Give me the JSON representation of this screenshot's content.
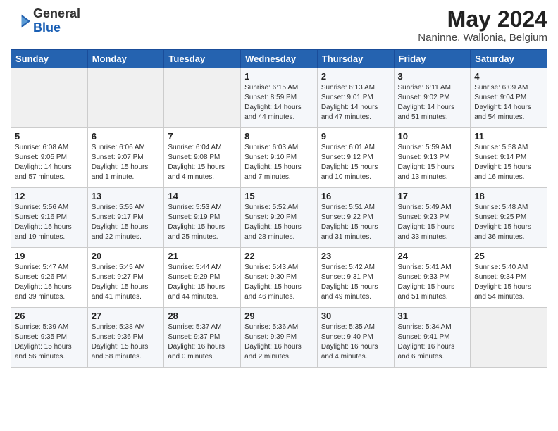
{
  "header": {
    "logo_general": "General",
    "logo_blue": "Blue",
    "month_title": "May 2024",
    "location": "Naninne, Wallonia, Belgium"
  },
  "weekdays": [
    "Sunday",
    "Monday",
    "Tuesday",
    "Wednesday",
    "Thursday",
    "Friday",
    "Saturday"
  ],
  "weeks": [
    [
      {
        "day": "",
        "info": ""
      },
      {
        "day": "",
        "info": ""
      },
      {
        "day": "",
        "info": ""
      },
      {
        "day": "1",
        "info": "Sunrise: 6:15 AM\nSunset: 8:59 PM\nDaylight: 14 hours\nand 44 minutes."
      },
      {
        "day": "2",
        "info": "Sunrise: 6:13 AM\nSunset: 9:01 PM\nDaylight: 14 hours\nand 47 minutes."
      },
      {
        "day": "3",
        "info": "Sunrise: 6:11 AM\nSunset: 9:02 PM\nDaylight: 14 hours\nand 51 minutes."
      },
      {
        "day": "4",
        "info": "Sunrise: 6:09 AM\nSunset: 9:04 PM\nDaylight: 14 hours\nand 54 minutes."
      }
    ],
    [
      {
        "day": "5",
        "info": "Sunrise: 6:08 AM\nSunset: 9:05 PM\nDaylight: 14 hours\nand 57 minutes."
      },
      {
        "day": "6",
        "info": "Sunrise: 6:06 AM\nSunset: 9:07 PM\nDaylight: 15 hours\nand 1 minute."
      },
      {
        "day": "7",
        "info": "Sunrise: 6:04 AM\nSunset: 9:08 PM\nDaylight: 15 hours\nand 4 minutes."
      },
      {
        "day": "8",
        "info": "Sunrise: 6:03 AM\nSunset: 9:10 PM\nDaylight: 15 hours\nand 7 minutes."
      },
      {
        "day": "9",
        "info": "Sunrise: 6:01 AM\nSunset: 9:12 PM\nDaylight: 15 hours\nand 10 minutes."
      },
      {
        "day": "10",
        "info": "Sunrise: 5:59 AM\nSunset: 9:13 PM\nDaylight: 15 hours\nand 13 minutes."
      },
      {
        "day": "11",
        "info": "Sunrise: 5:58 AM\nSunset: 9:14 PM\nDaylight: 15 hours\nand 16 minutes."
      }
    ],
    [
      {
        "day": "12",
        "info": "Sunrise: 5:56 AM\nSunset: 9:16 PM\nDaylight: 15 hours\nand 19 minutes."
      },
      {
        "day": "13",
        "info": "Sunrise: 5:55 AM\nSunset: 9:17 PM\nDaylight: 15 hours\nand 22 minutes."
      },
      {
        "day": "14",
        "info": "Sunrise: 5:53 AM\nSunset: 9:19 PM\nDaylight: 15 hours\nand 25 minutes."
      },
      {
        "day": "15",
        "info": "Sunrise: 5:52 AM\nSunset: 9:20 PM\nDaylight: 15 hours\nand 28 minutes."
      },
      {
        "day": "16",
        "info": "Sunrise: 5:51 AM\nSunset: 9:22 PM\nDaylight: 15 hours\nand 31 minutes."
      },
      {
        "day": "17",
        "info": "Sunrise: 5:49 AM\nSunset: 9:23 PM\nDaylight: 15 hours\nand 33 minutes."
      },
      {
        "day": "18",
        "info": "Sunrise: 5:48 AM\nSunset: 9:25 PM\nDaylight: 15 hours\nand 36 minutes."
      }
    ],
    [
      {
        "day": "19",
        "info": "Sunrise: 5:47 AM\nSunset: 9:26 PM\nDaylight: 15 hours\nand 39 minutes."
      },
      {
        "day": "20",
        "info": "Sunrise: 5:45 AM\nSunset: 9:27 PM\nDaylight: 15 hours\nand 41 minutes."
      },
      {
        "day": "21",
        "info": "Sunrise: 5:44 AM\nSunset: 9:29 PM\nDaylight: 15 hours\nand 44 minutes."
      },
      {
        "day": "22",
        "info": "Sunrise: 5:43 AM\nSunset: 9:30 PM\nDaylight: 15 hours\nand 46 minutes."
      },
      {
        "day": "23",
        "info": "Sunrise: 5:42 AM\nSunset: 9:31 PM\nDaylight: 15 hours\nand 49 minutes."
      },
      {
        "day": "24",
        "info": "Sunrise: 5:41 AM\nSunset: 9:33 PM\nDaylight: 15 hours\nand 51 minutes."
      },
      {
        "day": "25",
        "info": "Sunrise: 5:40 AM\nSunset: 9:34 PM\nDaylight: 15 hours\nand 54 minutes."
      }
    ],
    [
      {
        "day": "26",
        "info": "Sunrise: 5:39 AM\nSunset: 9:35 PM\nDaylight: 15 hours\nand 56 minutes."
      },
      {
        "day": "27",
        "info": "Sunrise: 5:38 AM\nSunset: 9:36 PM\nDaylight: 15 hours\nand 58 minutes."
      },
      {
        "day": "28",
        "info": "Sunrise: 5:37 AM\nSunset: 9:37 PM\nDaylight: 16 hours\nand 0 minutes."
      },
      {
        "day": "29",
        "info": "Sunrise: 5:36 AM\nSunset: 9:39 PM\nDaylight: 16 hours\nand 2 minutes."
      },
      {
        "day": "30",
        "info": "Sunrise: 5:35 AM\nSunset: 9:40 PM\nDaylight: 16 hours\nand 4 minutes."
      },
      {
        "day": "31",
        "info": "Sunrise: 5:34 AM\nSunset: 9:41 PM\nDaylight: 16 hours\nand 6 minutes."
      },
      {
        "day": "",
        "info": ""
      }
    ]
  ]
}
